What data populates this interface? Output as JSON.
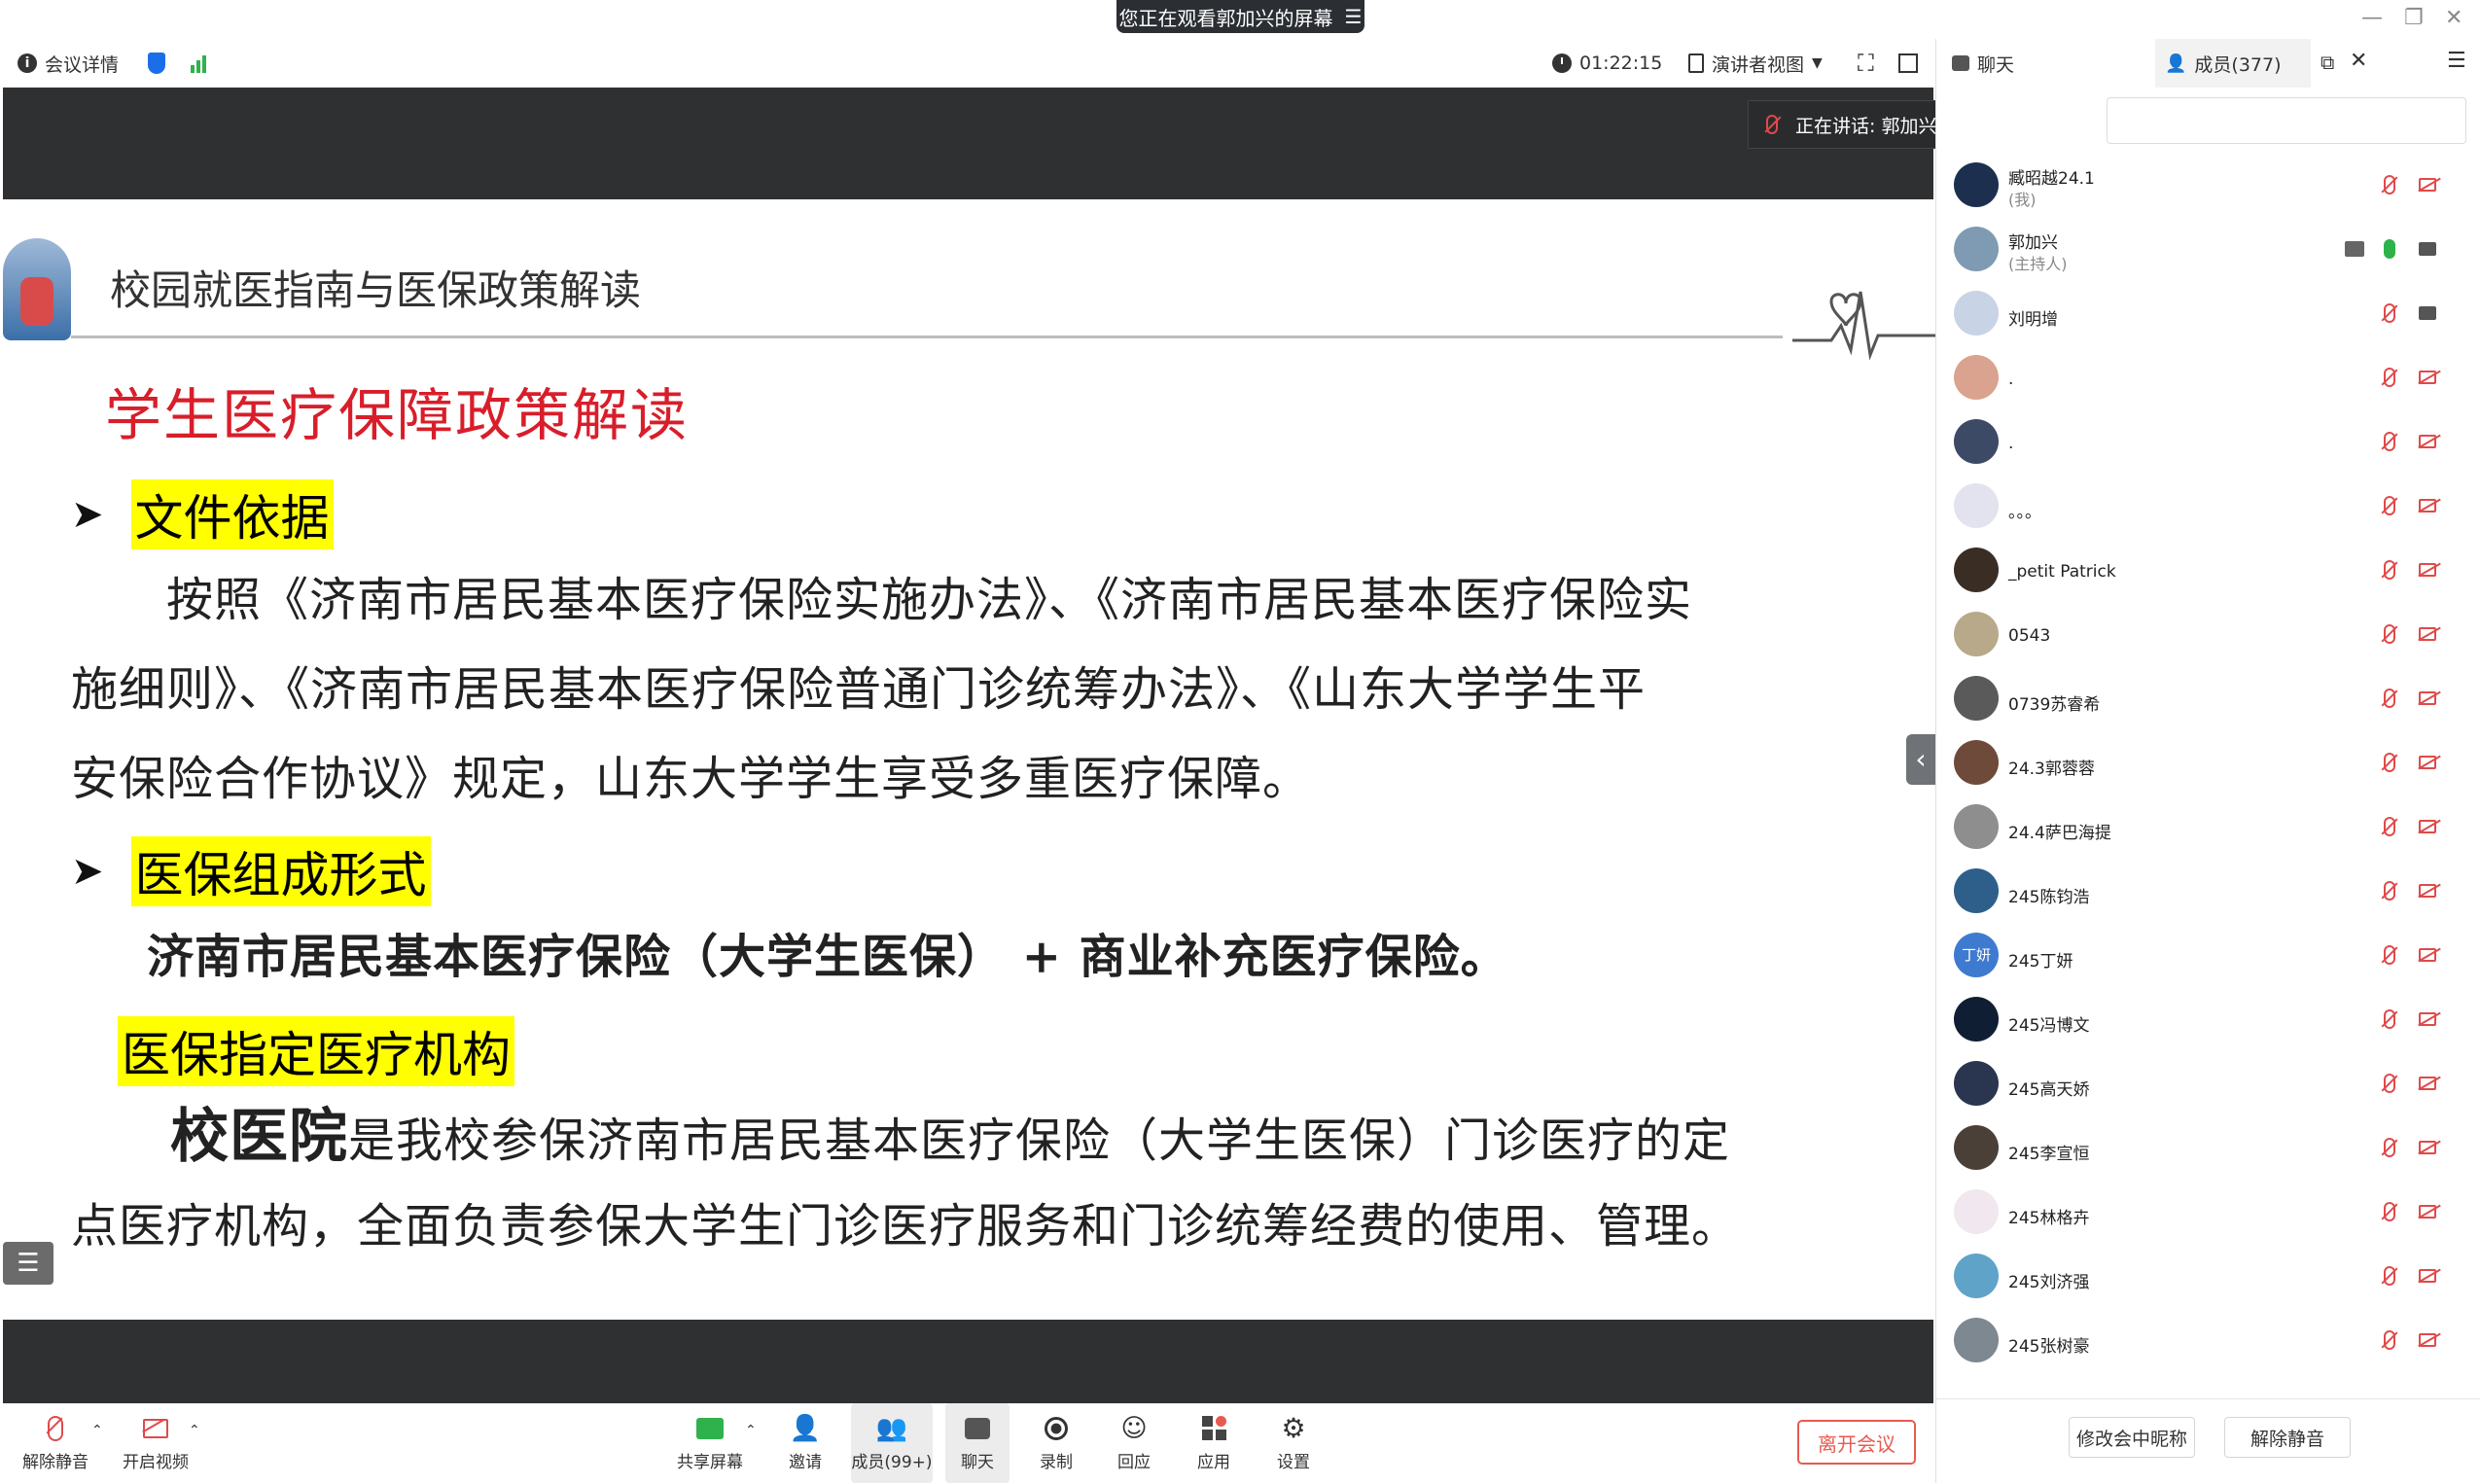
{
  "banner": {
    "text": "您正在观看郭加兴的屏幕",
    "menu_icon": "menu-icon"
  },
  "topbar": {
    "meeting_details": "会议详情",
    "timer": "01:22:15",
    "view_mode": "演讲者视图"
  },
  "speaking": {
    "label": "正在讲话:  郭加兴"
  },
  "slide": {
    "header_title": "校园就医指南与医保政策解读",
    "title": "学生医疗保障政策解读",
    "section1_heading": "文件依据",
    "section1_lines": [
      "按照《济南市居民基本医疗保险实施办法》、《济南市居民基本医疗保险实",
      "施细则》、《济南市居民基本医疗保险普通门诊统筹办法》、《山东大学学生平",
      "安保险合作协议》规定，山东大学学生享受多重医疗保障。"
    ],
    "section2_heading": "医保组成形式",
    "section2_line": "济南市居民基本医疗保险（大学生医保） + 商业补充医疗保险。",
    "section3_heading": "医保指定医疗机构",
    "section3_lead": "校医院",
    "section3_line1_rest": "是我校参保济南市居民基本医疗保险（大学生医保）门诊医疗的定",
    "section3_line2": "点医疗机构，全面负责参保大学生门诊医疗服务和门诊统筹经费的使用、管理。"
  },
  "toolbar": {
    "unmute": "解除静音",
    "start_video": "开启视频",
    "share_screen": "共享屏幕",
    "invite": "邀请",
    "members": "成员(99+)",
    "chat": "聊天",
    "record": "录制",
    "reactions": "回应",
    "apps": "应用",
    "settings": "设置",
    "leave": "离开会议"
  },
  "panel": {
    "chat_tab": "聊天",
    "members_tab": "成员(377)",
    "members": [
      {
        "name": "臧昭越24.1",
        "role": "(我)",
        "mic": "muted",
        "cam": "off",
        "avatar_color": "#1c2f4e"
      },
      {
        "name": "郭加兴",
        "role": "(主持人)",
        "mic": "on",
        "cam": "on",
        "sharing": true,
        "avatar_color": "#7f9bb3"
      },
      {
        "name": "刘明增",
        "role": "",
        "mic": "muted",
        "cam": "on",
        "avatar_color": "#c9d3e6"
      },
      {
        "name": ".",
        "role": "",
        "mic": "muted",
        "cam": "off",
        "avatar_color": "#d9a38f"
      },
      {
        "name": ".",
        "role": "",
        "mic": "muted",
        "cam": "off",
        "avatar_color": "#3d4a66"
      },
      {
        "name": "。。。",
        "role": "",
        "mic": "muted",
        "cam": "off",
        "avatar_color": "#e3e2ef"
      },
      {
        "name": "_petit Patrick",
        "role": "",
        "mic": "muted",
        "cam": "off",
        "avatar_color": "#3a2e24"
      },
      {
        "name": "0543",
        "role": "",
        "mic": "muted",
        "cam": "off",
        "avatar_color": "#b7a98a"
      },
      {
        "name": "0739苏睿希",
        "role": "",
        "mic": "muted",
        "cam": "off",
        "avatar_color": "#5a5a5a"
      },
      {
        "name": "24.3郭蓉蓉",
        "role": "",
        "mic": "muted",
        "cam": "off",
        "avatar_color": "#6e4a3a"
      },
      {
        "name": "24.4萨巴海提",
        "role": "",
        "mic": "muted",
        "cam": "off",
        "avatar_color": "#8e8e8e"
      },
      {
        "name": "245陈钧浩",
        "role": "",
        "mic": "muted",
        "cam": "off",
        "avatar_color": "#2e5f8a"
      },
      {
        "name": "245丁妍",
        "role": "",
        "mic": "muted",
        "cam": "off",
        "avatar_color": "#3f7ad1",
        "avatar_text": "丁妍"
      },
      {
        "name": "245冯博文",
        "role": "",
        "mic": "muted",
        "cam": "off",
        "avatar_color": "#0f1e33"
      },
      {
        "name": "245高天娇",
        "role": "",
        "mic": "muted",
        "cam": "off",
        "avatar_color": "#2a3550"
      },
      {
        "name": "245李宣恒",
        "role": "",
        "mic": "muted",
        "cam": "off",
        "avatar_color": "#4a4038"
      },
      {
        "name": "245林格卉",
        "role": "",
        "mic": "muted",
        "cam": "off",
        "avatar_color": "#f0e8ee"
      },
      {
        "name": "245刘济强",
        "role": "",
        "mic": "muted",
        "cam": "off",
        "avatar_color": "#5fa3c8"
      },
      {
        "name": "245张树豪",
        "role": "",
        "mic": "muted",
        "cam": "off",
        "avatar_color": "#7d8890"
      }
    ],
    "rename_button": "修改会中昵称",
    "unmute_button": "解除静音"
  }
}
